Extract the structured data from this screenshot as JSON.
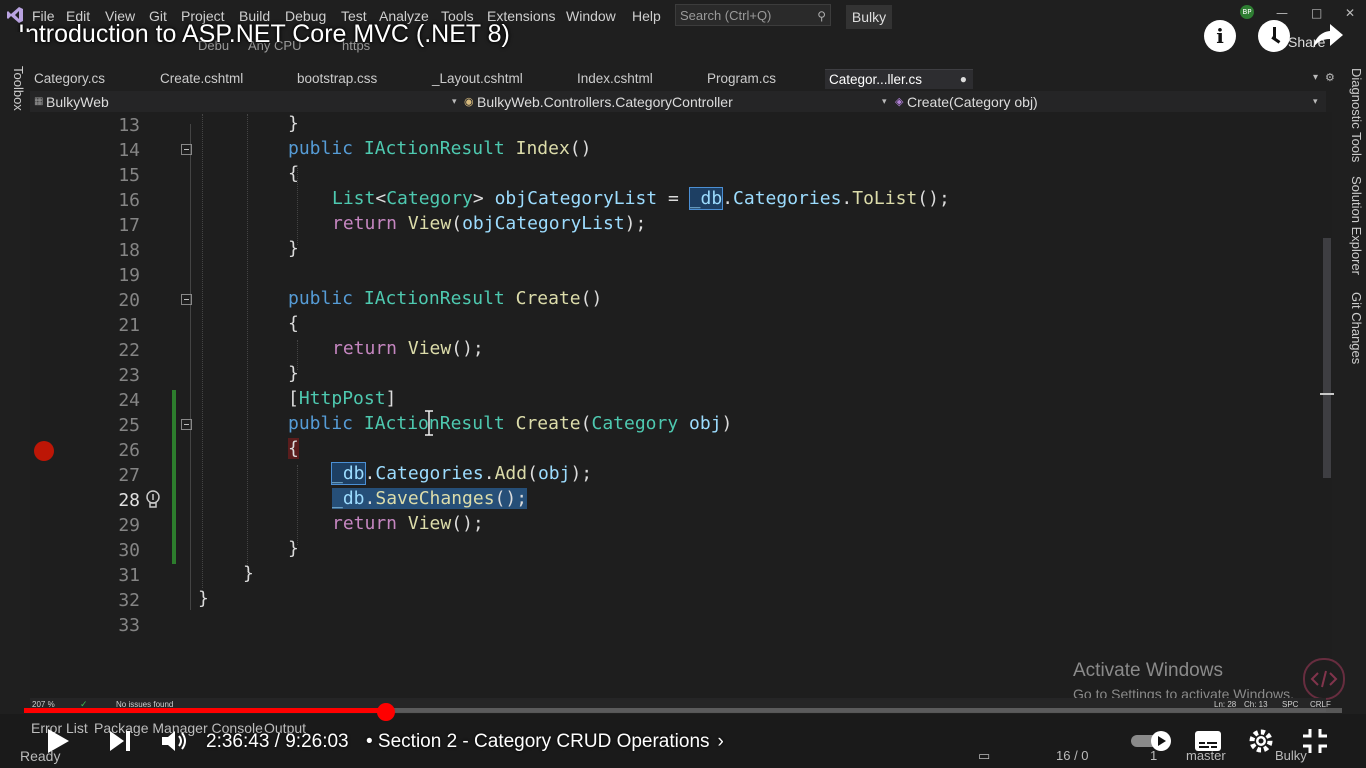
{
  "menu": {
    "items": [
      "File",
      "Edit",
      "View",
      "Git",
      "Project",
      "Build",
      "Debug",
      "Test",
      "Analyze",
      "Tools",
      "Extensions",
      "Window",
      "Help"
    ],
    "search_placeholder": "Search (Ctrl+Q)",
    "solution_name": "Bulky",
    "account_initials": "BP"
  },
  "video": {
    "title": "Introduction to ASP.NET Core MVC (.NET 8)",
    "toolbar_ghost": [
      "Debu",
      "Any CPU",
      "https"
    ],
    "share_label": "Share",
    "time": "2:36:43 / 9:26:03",
    "chapter": "• Section 2 - Category CRUD Operations",
    "progress_fraction": 0.275
  },
  "tabs": [
    {
      "label": "Category.cs",
      "active": false
    },
    {
      "label": "Create.cshtml",
      "active": false
    },
    {
      "label": "bootstrap.css",
      "active": false
    },
    {
      "label": "_Layout.cshtml",
      "active": false
    },
    {
      "label": "Index.cshtml",
      "active": false
    },
    {
      "label": "Program.cs",
      "active": false
    },
    {
      "label": "Categor...ller.cs",
      "active": true
    }
  ],
  "navbar": {
    "project": "BulkyWeb",
    "class": "BulkyWeb.Controllers.CategoryController",
    "member": "Create(Category obj)"
  },
  "side_panels": {
    "left": "Toolbox",
    "right": [
      "Diagnostic Tools",
      "Solution Explorer",
      "Git Changes"
    ]
  },
  "code": {
    "line_numbers": [
      "13",
      "14",
      "15",
      "16",
      "17",
      "18",
      "19",
      "20",
      "21",
      "22",
      "23",
      "24",
      "25",
      "26",
      "27",
      "28",
      "29",
      "30",
      "31",
      "32",
      "33"
    ],
    "current_line": "28"
  },
  "editor_status": {
    "zoom": "207 %",
    "issues": "No issues found",
    "ln": "Ln: 28",
    "ch": "Ch: 13",
    "spc": "SPC",
    "crlf": "CRLF"
  },
  "activate": {
    "title": "Activate Windows",
    "subtitle": "Go to Settings to activate Windows."
  },
  "bottom_panel": {
    "tabs": [
      "Error List",
      "Package Manager Console",
      "Output"
    ],
    "ready": "Ready",
    "sync": "16 / 0",
    "errors": "1",
    "branch": "master",
    "repo": "Bulky"
  },
  "colors": {
    "keyword": "#569cd6",
    "control_keyword": "#c586c0",
    "type": "#4ec9b0",
    "method": "#dcdcaa",
    "identifier": "#9cdcfe",
    "breakpoint": "#e51400",
    "progress": "#ff0000"
  }
}
